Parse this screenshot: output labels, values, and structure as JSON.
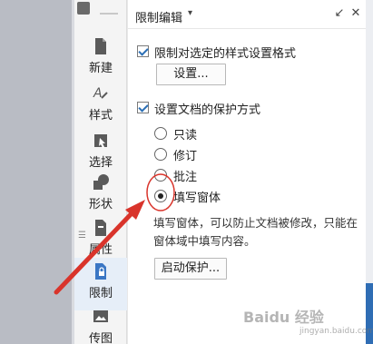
{
  "colors": {
    "accent": "#2b6fb5",
    "annotation_red": "#d9342b",
    "panel_bg": "#ffffff",
    "toolbar_bg": "#f4f4f4"
  },
  "toolbar": {
    "items": [
      {
        "label": "新建",
        "icon": "new-doc-icon"
      },
      {
        "label": "样式",
        "icon": "style-icon"
      },
      {
        "label": "选择",
        "icon": "select-icon"
      },
      {
        "label": "形状",
        "icon": "shape-icon"
      },
      {
        "label": "属性",
        "icon": "properties-icon"
      },
      {
        "label": "限制",
        "icon": "restrict-icon"
      },
      {
        "label": "传图",
        "icon": "upload-image-icon"
      }
    ]
  },
  "panel": {
    "title": "限制编辑",
    "format_restriction": {
      "checked": true,
      "label": "限制对选定的样式设置格式",
      "settings_button": "设置..."
    },
    "protection": {
      "checked": true,
      "label": "设置文档的保护方式",
      "options": [
        {
          "label": "只读",
          "selected": false
        },
        {
          "label": "修订",
          "selected": false
        },
        {
          "label": "批注",
          "selected": false
        },
        {
          "label": "填写窗体",
          "selected": true
        }
      ],
      "description": "填写窗体，可以防止文档被修改，只能在窗体域中填写内容。",
      "start_button": "启动保护..."
    }
  },
  "watermark": {
    "text": "Baidu 经验",
    "sub": "jingyan.baidu.com"
  }
}
